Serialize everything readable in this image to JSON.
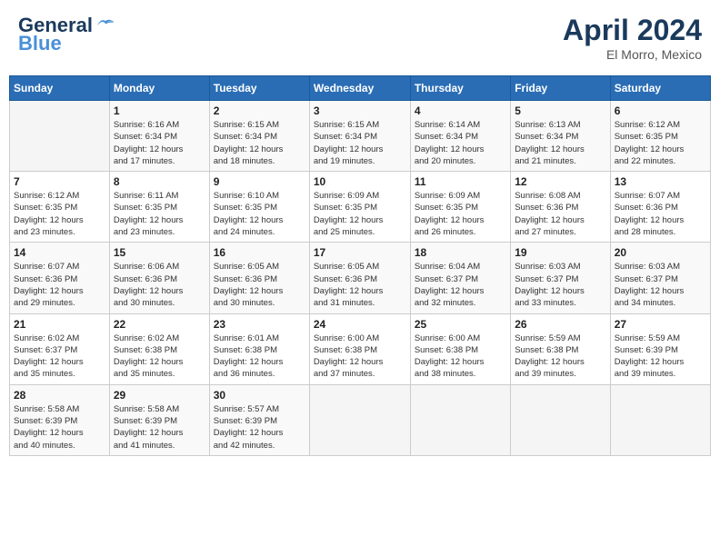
{
  "header": {
    "logo_general": "General",
    "logo_blue": "Blue",
    "month": "April 2024",
    "location": "El Morro, Mexico"
  },
  "days_of_week": [
    "Sunday",
    "Monday",
    "Tuesday",
    "Wednesday",
    "Thursday",
    "Friday",
    "Saturday"
  ],
  "weeks": [
    [
      {
        "day": "",
        "info": ""
      },
      {
        "day": "1",
        "info": "Sunrise: 6:16 AM\nSunset: 6:34 PM\nDaylight: 12 hours\nand 17 minutes."
      },
      {
        "day": "2",
        "info": "Sunrise: 6:15 AM\nSunset: 6:34 PM\nDaylight: 12 hours\nand 18 minutes."
      },
      {
        "day": "3",
        "info": "Sunrise: 6:15 AM\nSunset: 6:34 PM\nDaylight: 12 hours\nand 19 minutes."
      },
      {
        "day": "4",
        "info": "Sunrise: 6:14 AM\nSunset: 6:34 PM\nDaylight: 12 hours\nand 20 minutes."
      },
      {
        "day": "5",
        "info": "Sunrise: 6:13 AM\nSunset: 6:34 PM\nDaylight: 12 hours\nand 21 minutes."
      },
      {
        "day": "6",
        "info": "Sunrise: 6:12 AM\nSunset: 6:35 PM\nDaylight: 12 hours\nand 22 minutes."
      }
    ],
    [
      {
        "day": "7",
        "info": "Sunrise: 6:12 AM\nSunset: 6:35 PM\nDaylight: 12 hours\nand 23 minutes."
      },
      {
        "day": "8",
        "info": "Sunrise: 6:11 AM\nSunset: 6:35 PM\nDaylight: 12 hours\nand 23 minutes."
      },
      {
        "day": "9",
        "info": "Sunrise: 6:10 AM\nSunset: 6:35 PM\nDaylight: 12 hours\nand 24 minutes."
      },
      {
        "day": "10",
        "info": "Sunrise: 6:09 AM\nSunset: 6:35 PM\nDaylight: 12 hours\nand 25 minutes."
      },
      {
        "day": "11",
        "info": "Sunrise: 6:09 AM\nSunset: 6:35 PM\nDaylight: 12 hours\nand 26 minutes."
      },
      {
        "day": "12",
        "info": "Sunrise: 6:08 AM\nSunset: 6:36 PM\nDaylight: 12 hours\nand 27 minutes."
      },
      {
        "day": "13",
        "info": "Sunrise: 6:07 AM\nSunset: 6:36 PM\nDaylight: 12 hours\nand 28 minutes."
      }
    ],
    [
      {
        "day": "14",
        "info": "Sunrise: 6:07 AM\nSunset: 6:36 PM\nDaylight: 12 hours\nand 29 minutes."
      },
      {
        "day": "15",
        "info": "Sunrise: 6:06 AM\nSunset: 6:36 PM\nDaylight: 12 hours\nand 30 minutes."
      },
      {
        "day": "16",
        "info": "Sunrise: 6:05 AM\nSunset: 6:36 PM\nDaylight: 12 hours\nand 30 minutes."
      },
      {
        "day": "17",
        "info": "Sunrise: 6:05 AM\nSunset: 6:36 PM\nDaylight: 12 hours\nand 31 minutes."
      },
      {
        "day": "18",
        "info": "Sunrise: 6:04 AM\nSunset: 6:37 PM\nDaylight: 12 hours\nand 32 minutes."
      },
      {
        "day": "19",
        "info": "Sunrise: 6:03 AM\nSunset: 6:37 PM\nDaylight: 12 hours\nand 33 minutes."
      },
      {
        "day": "20",
        "info": "Sunrise: 6:03 AM\nSunset: 6:37 PM\nDaylight: 12 hours\nand 34 minutes."
      }
    ],
    [
      {
        "day": "21",
        "info": "Sunrise: 6:02 AM\nSunset: 6:37 PM\nDaylight: 12 hours\nand 35 minutes."
      },
      {
        "day": "22",
        "info": "Sunrise: 6:02 AM\nSunset: 6:38 PM\nDaylight: 12 hours\nand 35 minutes."
      },
      {
        "day": "23",
        "info": "Sunrise: 6:01 AM\nSunset: 6:38 PM\nDaylight: 12 hours\nand 36 minutes."
      },
      {
        "day": "24",
        "info": "Sunrise: 6:00 AM\nSunset: 6:38 PM\nDaylight: 12 hours\nand 37 minutes."
      },
      {
        "day": "25",
        "info": "Sunrise: 6:00 AM\nSunset: 6:38 PM\nDaylight: 12 hours\nand 38 minutes."
      },
      {
        "day": "26",
        "info": "Sunrise: 5:59 AM\nSunset: 6:38 PM\nDaylight: 12 hours\nand 39 minutes."
      },
      {
        "day": "27",
        "info": "Sunrise: 5:59 AM\nSunset: 6:39 PM\nDaylight: 12 hours\nand 39 minutes."
      }
    ],
    [
      {
        "day": "28",
        "info": "Sunrise: 5:58 AM\nSunset: 6:39 PM\nDaylight: 12 hours\nand 40 minutes."
      },
      {
        "day": "29",
        "info": "Sunrise: 5:58 AM\nSunset: 6:39 PM\nDaylight: 12 hours\nand 41 minutes."
      },
      {
        "day": "30",
        "info": "Sunrise: 5:57 AM\nSunset: 6:39 PM\nDaylight: 12 hours\nand 42 minutes."
      },
      {
        "day": "",
        "info": ""
      },
      {
        "day": "",
        "info": ""
      },
      {
        "day": "",
        "info": ""
      },
      {
        "day": "",
        "info": ""
      }
    ]
  ]
}
